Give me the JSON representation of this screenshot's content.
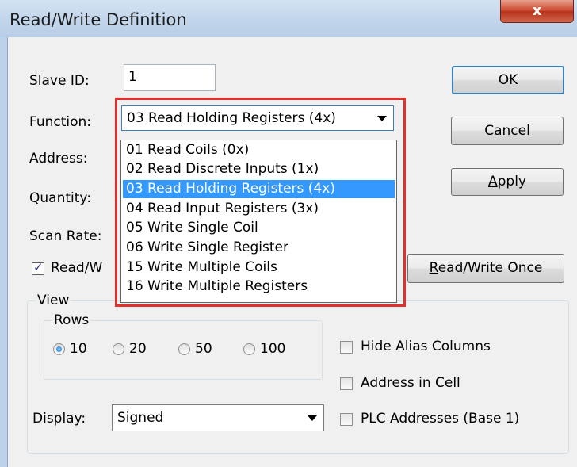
{
  "window": {
    "title": "Read/Write Definition",
    "close_glyph": "x"
  },
  "fields": {
    "slave_id": {
      "label": "Slave ID:",
      "value": "1"
    },
    "function": {
      "label": "Function:",
      "value": "03 Read Holding Registers (4x)"
    },
    "address": {
      "label": "Address:"
    },
    "quantity": {
      "label": "Quantity:"
    },
    "scan_rate": {
      "label": "Scan Rate:"
    },
    "read_write_enabled": {
      "label": "Read/W",
      "checked": true
    }
  },
  "function_options": [
    "01 Read Coils (0x)",
    "02 Read Discrete Inputs (1x)",
    "03 Read Holding Registers (4x)",
    "04 Read Input Registers (3x)",
    "05 Write Single Coil",
    "06 Write Single Register",
    "15 Write Multiple Coils",
    "16 Write Multiple Registers"
  ],
  "selected_function_index": 2,
  "buttons": {
    "ok": "OK",
    "cancel": "Cancel",
    "apply_accel": "A",
    "apply_rest": "pply",
    "rw_once_accel": "R",
    "rw_once_rest": "ead/Write Once"
  },
  "view": {
    "caption": "View",
    "rows": {
      "caption": "Rows",
      "options": [
        "10",
        "20",
        "50",
        "100"
      ],
      "selected": "10"
    },
    "display": {
      "label": "Display:",
      "value": "Signed"
    },
    "options": {
      "hide_alias": {
        "label": "Hide Alias Columns",
        "checked": false
      },
      "address_in_cell": {
        "label": "Address in Cell",
        "checked": false
      },
      "plc_addresses": {
        "label": "PLC Addresses (Base 1)",
        "checked": false
      }
    }
  },
  "colors": {
    "highlight": "#3399ff",
    "annotation_border": "#e0312e",
    "close_button": "#c9462c"
  }
}
